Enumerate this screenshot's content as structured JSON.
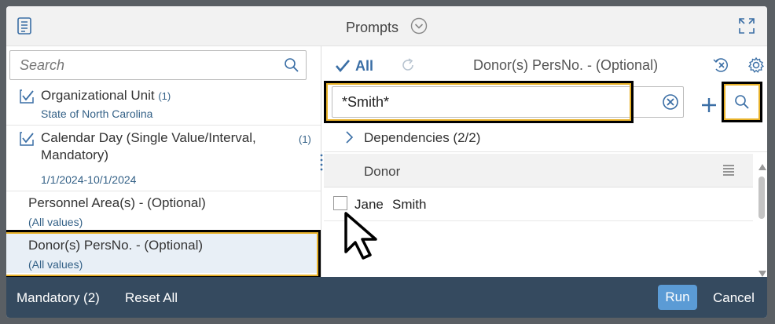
{
  "dialog": {
    "title": "Prompts"
  },
  "left": {
    "search_placeholder": "Search",
    "items": [
      {
        "label": "Organizational Unit",
        "count": "(1)",
        "value": "State of North Carolina"
      },
      {
        "label_line1": "Calendar Day (Single Value/Interval,",
        "label_line2": "Mandatory)",
        "count": "(1)",
        "value": "1/1/2024-10/1/2024"
      },
      {
        "label": "Personnel Area(s) - (Optional)",
        "value": "(All values)"
      },
      {
        "label": "Donor(s) PersNo. - (Optional)",
        "value": "(All values)"
      }
    ]
  },
  "right": {
    "all_label": "All",
    "prompt_title": "Donor(s) PersNo. - (Optional)",
    "search_value": "*Smith*",
    "dependencies_label": "Dependencies (2/2)",
    "column_header": "Donor",
    "rows": [
      {
        "first": "Jane",
        "last": "Smith"
      }
    ]
  },
  "footer": {
    "mandatory_label": "Mandatory (2)",
    "reset_label": "Reset All",
    "run_label": "Run",
    "cancel_label": "Cancel"
  },
  "colors": {
    "footer_bg": "#354a5f",
    "run_button": "#5b9bd5",
    "link_blue": "#346187",
    "highlight_outline": "#e8b22a"
  }
}
